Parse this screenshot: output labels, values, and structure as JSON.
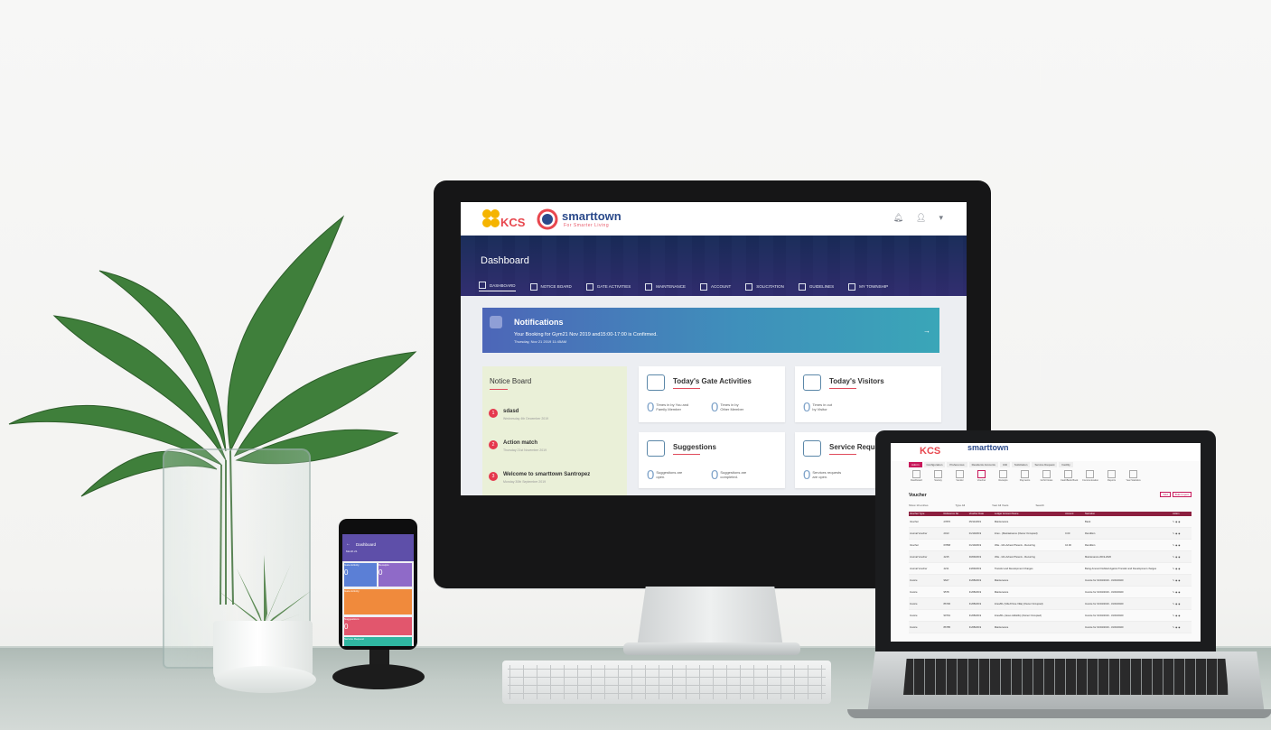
{
  "monitor": {
    "brand": {
      "kcs": "KCS",
      "name": "smarttown",
      "tagline": "For Smarter Living"
    },
    "page_title": "Dashboard",
    "nav": [
      "DASHBOARD",
      "NOTICE BOARD",
      "GATE ACTIVITIES",
      "MAINTENANCE",
      "ACCOUNT",
      "SOLICITATION",
      "GUIDELINES",
      "MY TOWNSHIP"
    ],
    "notification": {
      "title": "Notifications",
      "text": "Your Booking for Gym21 Nov 2019 and15:00-17:00 is Confirmed.",
      "time": "Thursday, Nov 21 2019 11:45AM",
      "arrow": "→"
    },
    "notice_board": {
      "title": "Notice Board",
      "items": [
        {
          "num": "1",
          "title": "sdasd",
          "date": "Wednesday 4th December 2019"
        },
        {
          "num": "2",
          "title": "Action match",
          "date": "Thursday 21st November 2019"
        },
        {
          "num": "3",
          "title": "Welcome to smarttown Santropez",
          "date": "Monday 30th September 2019"
        }
      ]
    },
    "gate": {
      "title": "Today's Gate Activities",
      "stats": [
        {
          "value": "0",
          "label": "Times in by You and\nFamily Member"
        },
        {
          "value": "0",
          "label": "Times in by\nOther Member"
        }
      ]
    },
    "visitors": {
      "title": "Today's Visitors",
      "stat": {
        "value": "0",
        "label": "Times in out\nby Visitor"
      }
    },
    "suggestions": {
      "title": "Suggestions",
      "stats": [
        {
          "value": "0",
          "label": "Suggestions are\nopen."
        },
        {
          "value": "0",
          "label": "Suggestions are\ncompleted."
        }
      ]
    },
    "service": {
      "title": "Service Requ",
      "stat": {
        "value": "0",
        "label": "Services requests\nare open."
      }
    }
  },
  "phone": {
    "title": "Dashboard",
    "subtitle": "Month 21",
    "tiles": [
      {
        "label": "Gate Activity",
        "value": "0",
        "color": "#5b7fd6"
      },
      {
        "label": "Receipts",
        "value": "0",
        "color": "#8f6ac8"
      },
      {
        "label": "Gate Activity",
        "value": "",
        "color": "#f08a3c"
      },
      {
        "label": "Suggestions",
        "value": "0",
        "color": "#e2566d"
      },
      {
        "label": "Service Request",
        "value": "0",
        "color": "#2fb6a1"
      }
    ]
  },
  "laptop": {
    "tabs": [
      "Admin",
      "Configuration",
      "Preferences",
      "Residents Accounts",
      "Utili",
      "Solicitation",
      "Service Request",
      "Facility"
    ],
    "tools": [
      "Dashboard",
      "Society",
      "Vendor",
      "Voucher",
      "Receipts",
      "Payments",
      "Gr/Gl Notes",
      "Cash/Bank Book",
      "Communication",
      "Reports",
      "Year Statistics"
    ],
    "heading": "Voucher",
    "buttons": [
      "Add",
      "Bulk Import"
    ],
    "filters": [
      "Show 10 entries",
      "Type All",
      "Year All Years",
      "Search"
    ],
    "columns": [
      "Voucher Type",
      "Reference No",
      "Voucher Date",
      "Ledger Account Name",
      "Amount",
      "Narration",
      "Action"
    ],
    "rows": [
      [
        "Voucher",
        "27870",
        "05/11/2019",
        "Maintenance",
        "",
        "Bank",
        ""
      ],
      [
        "Journal Voucher",
        "2013",
        "01/10/2019",
        "Intex - (Maintainance (Owner Occupied)",
        "0.00",
        "Rendition",
        ""
      ],
      [
        "Voucher",
        "67868",
        "01/10/2019",
        "Villa - 101-Arbest Phoenix - Recurring",
        "10.00",
        "Rendition",
        ""
      ],
      [
        "Journal Voucher",
        "4215",
        "30/09/2019",
        "Villa - 101-Arbest Phoenix - Recurring",
        "",
        "Maintenance 2019-2020",
        ""
      ],
      [
        "Journal Voucher",
        "4211",
        "24/09/2019",
        "Transfer and Development Charges",
        "",
        "Being Amount Debited Against Transfer and Development charges",
        ""
      ],
      [
        "Invoice",
        "9627",
        "31/08/2019",
        "Maintenance",
        "",
        "Invoice for 01/04/2019 - 31/03/2020",
        ""
      ],
      [
        "Invoice",
        "9578",
        "31/08/2019",
        "Maintenance",
        "",
        "Invoice for 01/04/2019 - 31/03/2020",
        ""
      ],
      [
        "Invoice",
        "86700",
        "31/08/2019",
        "Intex/RL (Villa 8 Noe Villa) (Owner Occupied)",
        "",
        "Invoice for 01/04/2019 - 31/03/2020",
        ""
      ],
      [
        "Invoice",
        "90791",
        "31/08/2019",
        "Intex/RL (Jesus Aldotillo) (Owner Occupied)",
        "",
        "Invoice for 01/04/2019 - 31/03/2020",
        ""
      ],
      [
        "Invoice",
        "86785",
        "31/08/2019",
        "Maintenance",
        "",
        "Invoice for 01/04/2019 - 31/03/2020",
        ""
      ]
    ]
  }
}
